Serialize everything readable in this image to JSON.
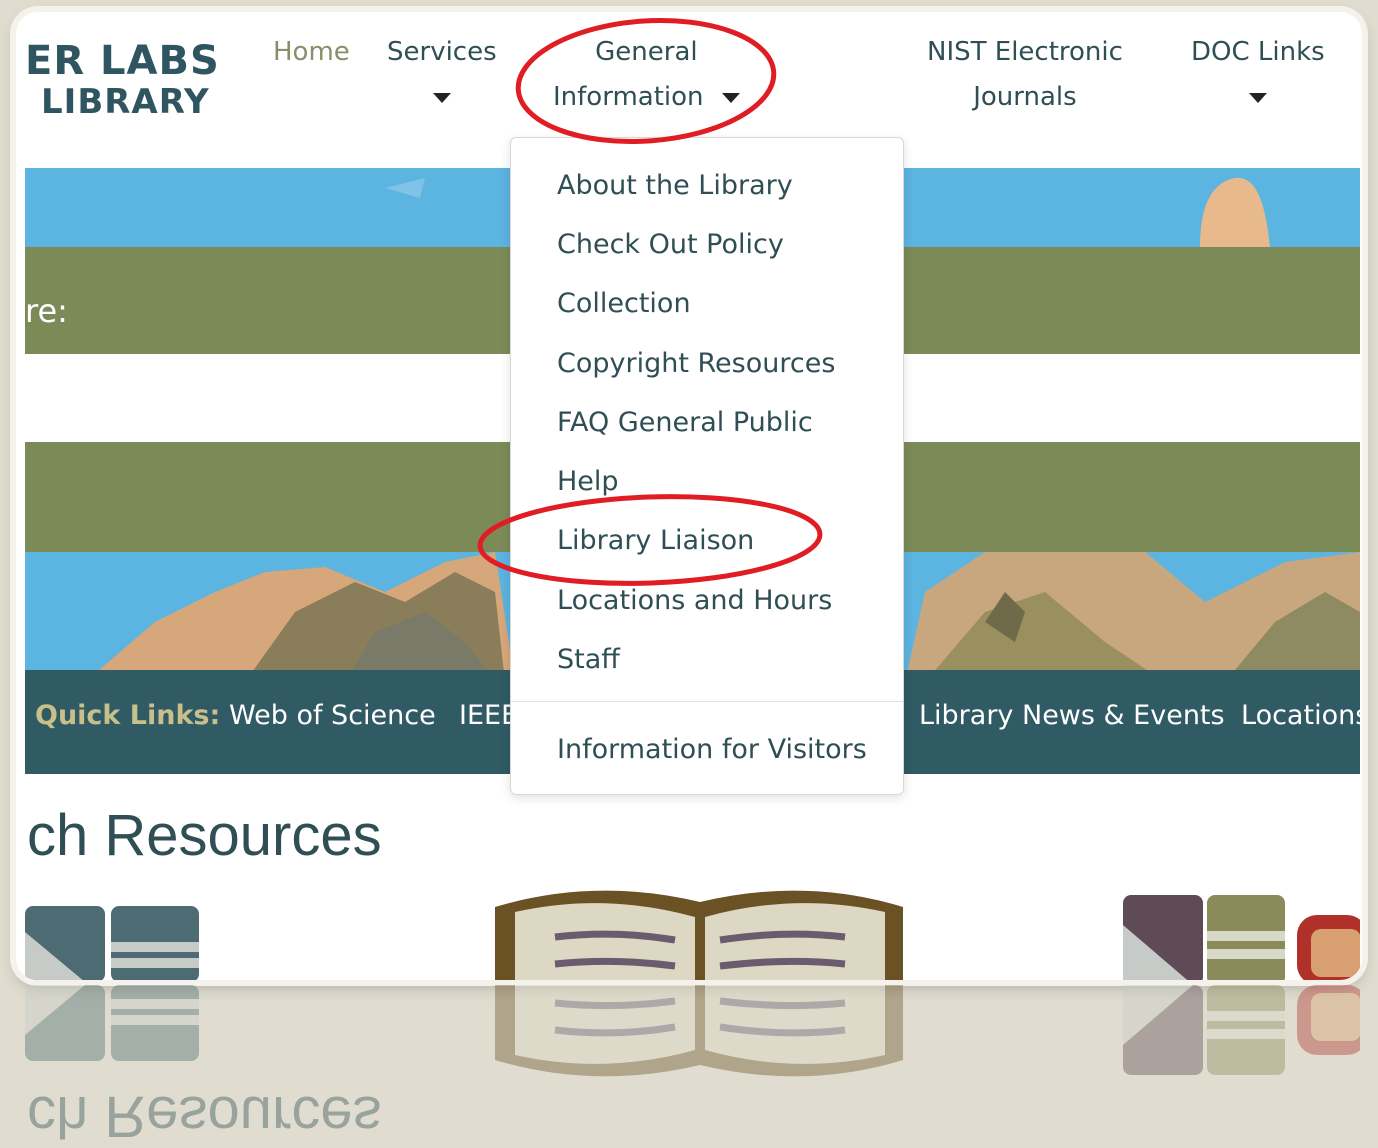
{
  "header": {
    "logo_line1": "ER LABS",
    "logo_line2": "LIBRARY",
    "nav": [
      {
        "label": "Home"
      },
      {
        "label": "Services"
      },
      {
        "label_line1": "General",
        "label_line2": "Information"
      },
      {
        "label_line1": "NIST Electronic",
        "label_line2": "Journals"
      },
      {
        "label": "DOC Links"
      }
    ]
  },
  "banner": {
    "text": "re:"
  },
  "dropdown": {
    "items": [
      "About the Library",
      "Check Out Policy",
      "Collection",
      "Copyright Resources",
      "FAQ General Public",
      "Help",
      "Library Liaison",
      "Locations and Hours",
      "Staff"
    ],
    "footer_item": "Information for Visitors"
  },
  "quick_links": {
    "label": "Quick Links:",
    "links": [
      "Web of Science",
      "IEEE",
      "Library News & Events",
      "Locations"
    ]
  },
  "section": {
    "title": "ch Resources"
  },
  "colors": {
    "accent_nav": "#2f4f55",
    "active_nav": "#8a8f6a",
    "quick_bar": "#305a64",
    "band": "#7c8a58",
    "sky": "#5cb4e0",
    "highlight_ring": "#e01d24"
  }
}
